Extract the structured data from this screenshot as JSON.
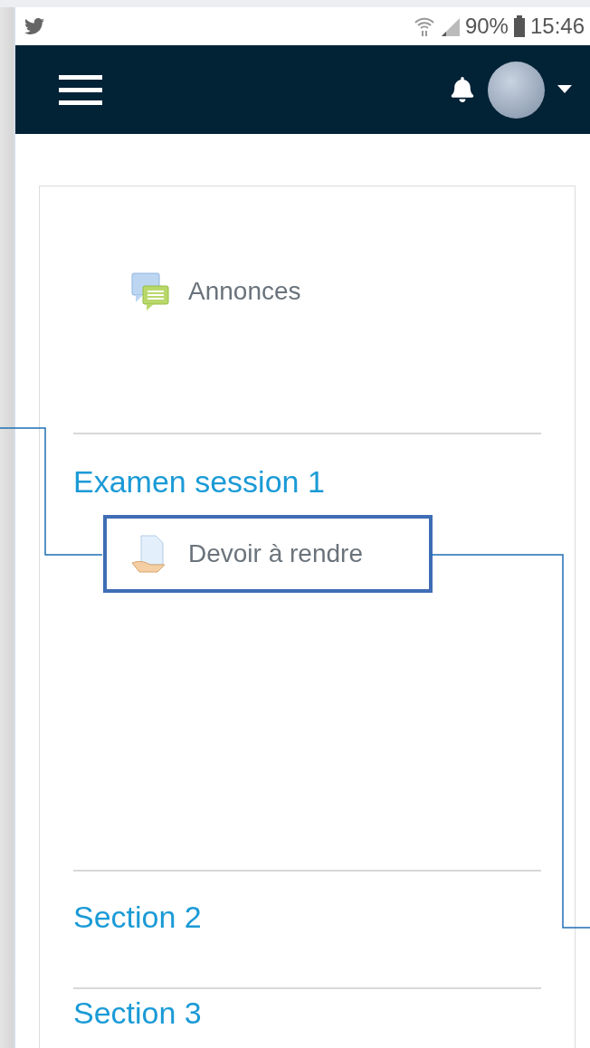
{
  "status_bar": {
    "battery": "90%",
    "time": "15:46"
  },
  "top_activities": [
    {
      "title": "Annonces",
      "kind": "forum",
      "highlighted": false
    }
  ],
  "sections": [
    {
      "title": "Examen session 1",
      "activities": [
        {
          "title": "Devoir à rendre",
          "kind": "assignment",
          "highlighted": true
        }
      ]
    },
    {
      "title": "Section 2"
    },
    {
      "title": "Section 3"
    }
  ]
}
